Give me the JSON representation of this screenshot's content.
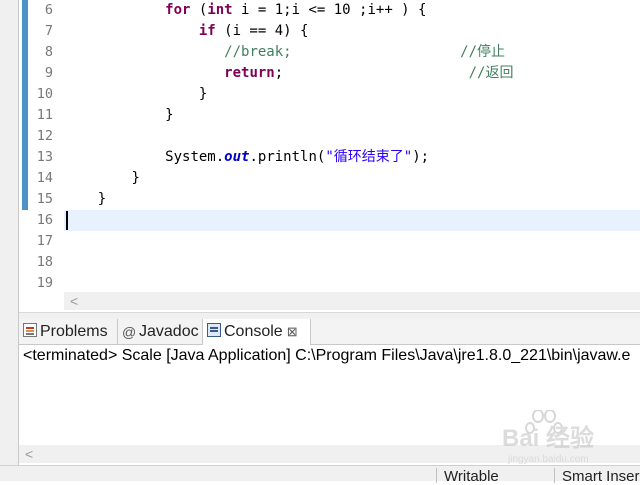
{
  "editor": {
    "lines": [
      {
        "num": "6"
      },
      {
        "num": "7"
      },
      {
        "num": "8"
      },
      {
        "num": "9"
      },
      {
        "num": "10"
      },
      {
        "num": "11"
      },
      {
        "num": "12"
      },
      {
        "num": "13"
      },
      {
        "num": "14"
      },
      {
        "num": "15"
      },
      {
        "num": "16"
      },
      {
        "num": "17"
      },
      {
        "num": "18"
      },
      {
        "num": "19"
      }
    ],
    "code": {
      "l6": {
        "kw1": "for",
        "p1": " (",
        "kw2": "int",
        "p2": " i = 1;i <= 10 ;i++ ) {"
      },
      "l7": {
        "kw1": "if",
        "p1": " (i == 4) {"
      },
      "l8": {
        "comment1": "//break;",
        "comment2": "//停止"
      },
      "l9": {
        "kw1": "return",
        "p1": ";",
        "comment2": "//返回"
      },
      "l10": {
        "p1": "}"
      },
      "l11": {
        "p1": "}"
      },
      "l13": {
        "p1": "System.",
        "field": "out",
        "p2": ".println(",
        "str": "\"循环结束了\"",
        "p3": ");"
      },
      "l14": {
        "p1": "}"
      },
      "l15": {
        "p1": "}"
      }
    }
  },
  "console_view": {
    "tabs": [
      {
        "label": "Problems",
        "icon": "problems-icon"
      },
      {
        "label": "Javadoc",
        "icon": "javadoc-icon",
        "glyph": "@"
      },
      {
        "label": "Console",
        "icon": "console-icon",
        "close": "⊠"
      }
    ],
    "status": "<terminated> Scale [Java Application] C:\\Program Files\\Java\\jre1.8.0_221\\bin\\javaw.e"
  },
  "statusbar": {
    "writable": "Writable",
    "insert_mode": "Smart Inser"
  },
  "scroll_arrow": "<",
  "watermark": {
    "text": "Bai 经验",
    "sub": "jingyan.baidu.com"
  }
}
